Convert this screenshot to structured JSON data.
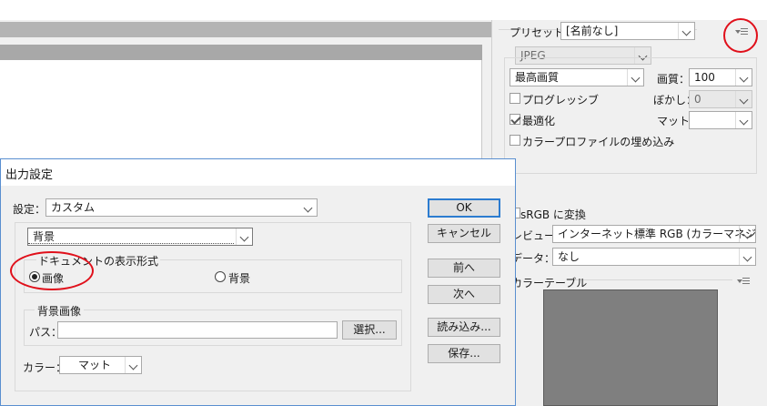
{
  "right_panel": {
    "preset_label": "プリセット：",
    "preset_value": "[名前なし]",
    "format_value": "JPEG",
    "quality_select": "最高画質",
    "quality_label": "画質：",
    "quality_value": "100",
    "progressive_label": "プログレッシブ",
    "blur_label": "ぼかし：",
    "blur_value": "0",
    "optimize_label": "最適化",
    "matte_label": "マット：",
    "embed_profile_label": "カラープロファイルの埋め込み",
    "srgb_label": "sRGB に変換",
    "preview_label": "レビュー：",
    "preview_value": "インターネット標準 RGB (カラーマネジメ...",
    "metadata_label": "データ：",
    "metadata_value": "なし",
    "color_table_label": "カラーテーブル",
    "matte_color": "#7f7f7f",
    "progressive_checked": false,
    "optimize_checked": true,
    "embed_profile_checked": false
  },
  "dialog": {
    "title": "出力設定",
    "settings_label": "設定：",
    "settings_value": "カスタム",
    "category_value": "背景",
    "doc_display_group_label": "ドキュメントの表示形式",
    "radio_image_label": "画像",
    "radio_background_label": "背景",
    "bg_image_group_label": "背景画像",
    "path_label": "パス：",
    "path_value": "",
    "browse_button": "選択...",
    "color_label": "カラー：",
    "color_value": "マット",
    "ok_button": "OK",
    "cancel_button": "キャンセル",
    "prev_button": "前へ",
    "next_button": "次へ",
    "load_button": "読み込み...",
    "save_button": "保存...",
    "selected_radio": "image"
  },
  "annotations": {
    "highlight_color": "#e0101b"
  }
}
